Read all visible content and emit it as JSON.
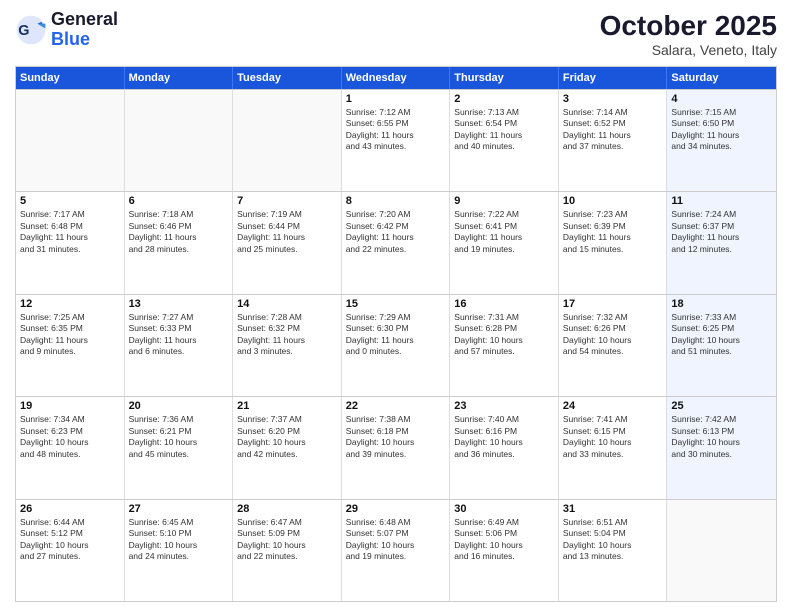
{
  "header": {
    "logo_general": "General",
    "logo_blue": "Blue",
    "title": "October 2025",
    "subtitle": "Salara, Veneto, Italy"
  },
  "weekdays": [
    "Sunday",
    "Monday",
    "Tuesday",
    "Wednesday",
    "Thursday",
    "Friday",
    "Saturday"
  ],
  "weeks": [
    [
      {
        "day": "",
        "info": ""
      },
      {
        "day": "",
        "info": ""
      },
      {
        "day": "",
        "info": ""
      },
      {
        "day": "1",
        "info": "Sunrise: 7:12 AM\nSunset: 6:55 PM\nDaylight: 11 hours\nand 43 minutes."
      },
      {
        "day": "2",
        "info": "Sunrise: 7:13 AM\nSunset: 6:54 PM\nDaylight: 11 hours\nand 40 minutes."
      },
      {
        "day": "3",
        "info": "Sunrise: 7:14 AM\nSunset: 6:52 PM\nDaylight: 11 hours\nand 37 minutes."
      },
      {
        "day": "4",
        "info": "Sunrise: 7:15 AM\nSunset: 6:50 PM\nDaylight: 11 hours\nand 34 minutes."
      }
    ],
    [
      {
        "day": "5",
        "info": "Sunrise: 7:17 AM\nSunset: 6:48 PM\nDaylight: 11 hours\nand 31 minutes."
      },
      {
        "day": "6",
        "info": "Sunrise: 7:18 AM\nSunset: 6:46 PM\nDaylight: 11 hours\nand 28 minutes."
      },
      {
        "day": "7",
        "info": "Sunrise: 7:19 AM\nSunset: 6:44 PM\nDaylight: 11 hours\nand 25 minutes."
      },
      {
        "day": "8",
        "info": "Sunrise: 7:20 AM\nSunset: 6:42 PM\nDaylight: 11 hours\nand 22 minutes."
      },
      {
        "day": "9",
        "info": "Sunrise: 7:22 AM\nSunset: 6:41 PM\nDaylight: 11 hours\nand 19 minutes."
      },
      {
        "day": "10",
        "info": "Sunrise: 7:23 AM\nSunset: 6:39 PM\nDaylight: 11 hours\nand 15 minutes."
      },
      {
        "day": "11",
        "info": "Sunrise: 7:24 AM\nSunset: 6:37 PM\nDaylight: 11 hours\nand 12 minutes."
      }
    ],
    [
      {
        "day": "12",
        "info": "Sunrise: 7:25 AM\nSunset: 6:35 PM\nDaylight: 11 hours\nand 9 minutes."
      },
      {
        "day": "13",
        "info": "Sunrise: 7:27 AM\nSunset: 6:33 PM\nDaylight: 11 hours\nand 6 minutes."
      },
      {
        "day": "14",
        "info": "Sunrise: 7:28 AM\nSunset: 6:32 PM\nDaylight: 11 hours\nand 3 minutes."
      },
      {
        "day": "15",
        "info": "Sunrise: 7:29 AM\nSunset: 6:30 PM\nDaylight: 11 hours\nand 0 minutes."
      },
      {
        "day": "16",
        "info": "Sunrise: 7:31 AM\nSunset: 6:28 PM\nDaylight: 10 hours\nand 57 minutes."
      },
      {
        "day": "17",
        "info": "Sunrise: 7:32 AM\nSunset: 6:26 PM\nDaylight: 10 hours\nand 54 minutes."
      },
      {
        "day": "18",
        "info": "Sunrise: 7:33 AM\nSunset: 6:25 PM\nDaylight: 10 hours\nand 51 minutes."
      }
    ],
    [
      {
        "day": "19",
        "info": "Sunrise: 7:34 AM\nSunset: 6:23 PM\nDaylight: 10 hours\nand 48 minutes."
      },
      {
        "day": "20",
        "info": "Sunrise: 7:36 AM\nSunset: 6:21 PM\nDaylight: 10 hours\nand 45 minutes."
      },
      {
        "day": "21",
        "info": "Sunrise: 7:37 AM\nSunset: 6:20 PM\nDaylight: 10 hours\nand 42 minutes."
      },
      {
        "day": "22",
        "info": "Sunrise: 7:38 AM\nSunset: 6:18 PM\nDaylight: 10 hours\nand 39 minutes."
      },
      {
        "day": "23",
        "info": "Sunrise: 7:40 AM\nSunset: 6:16 PM\nDaylight: 10 hours\nand 36 minutes."
      },
      {
        "day": "24",
        "info": "Sunrise: 7:41 AM\nSunset: 6:15 PM\nDaylight: 10 hours\nand 33 minutes."
      },
      {
        "day": "25",
        "info": "Sunrise: 7:42 AM\nSunset: 6:13 PM\nDaylight: 10 hours\nand 30 minutes."
      }
    ],
    [
      {
        "day": "26",
        "info": "Sunrise: 6:44 AM\nSunset: 5:12 PM\nDaylight: 10 hours\nand 27 minutes."
      },
      {
        "day": "27",
        "info": "Sunrise: 6:45 AM\nSunset: 5:10 PM\nDaylight: 10 hours\nand 24 minutes."
      },
      {
        "day": "28",
        "info": "Sunrise: 6:47 AM\nSunset: 5:09 PM\nDaylight: 10 hours\nand 22 minutes."
      },
      {
        "day": "29",
        "info": "Sunrise: 6:48 AM\nSunset: 5:07 PM\nDaylight: 10 hours\nand 19 minutes."
      },
      {
        "day": "30",
        "info": "Sunrise: 6:49 AM\nSunset: 5:06 PM\nDaylight: 10 hours\nand 16 minutes."
      },
      {
        "day": "31",
        "info": "Sunrise: 6:51 AM\nSunset: 5:04 PM\nDaylight: 10 hours\nand 13 minutes."
      },
      {
        "day": "",
        "info": ""
      }
    ]
  ]
}
